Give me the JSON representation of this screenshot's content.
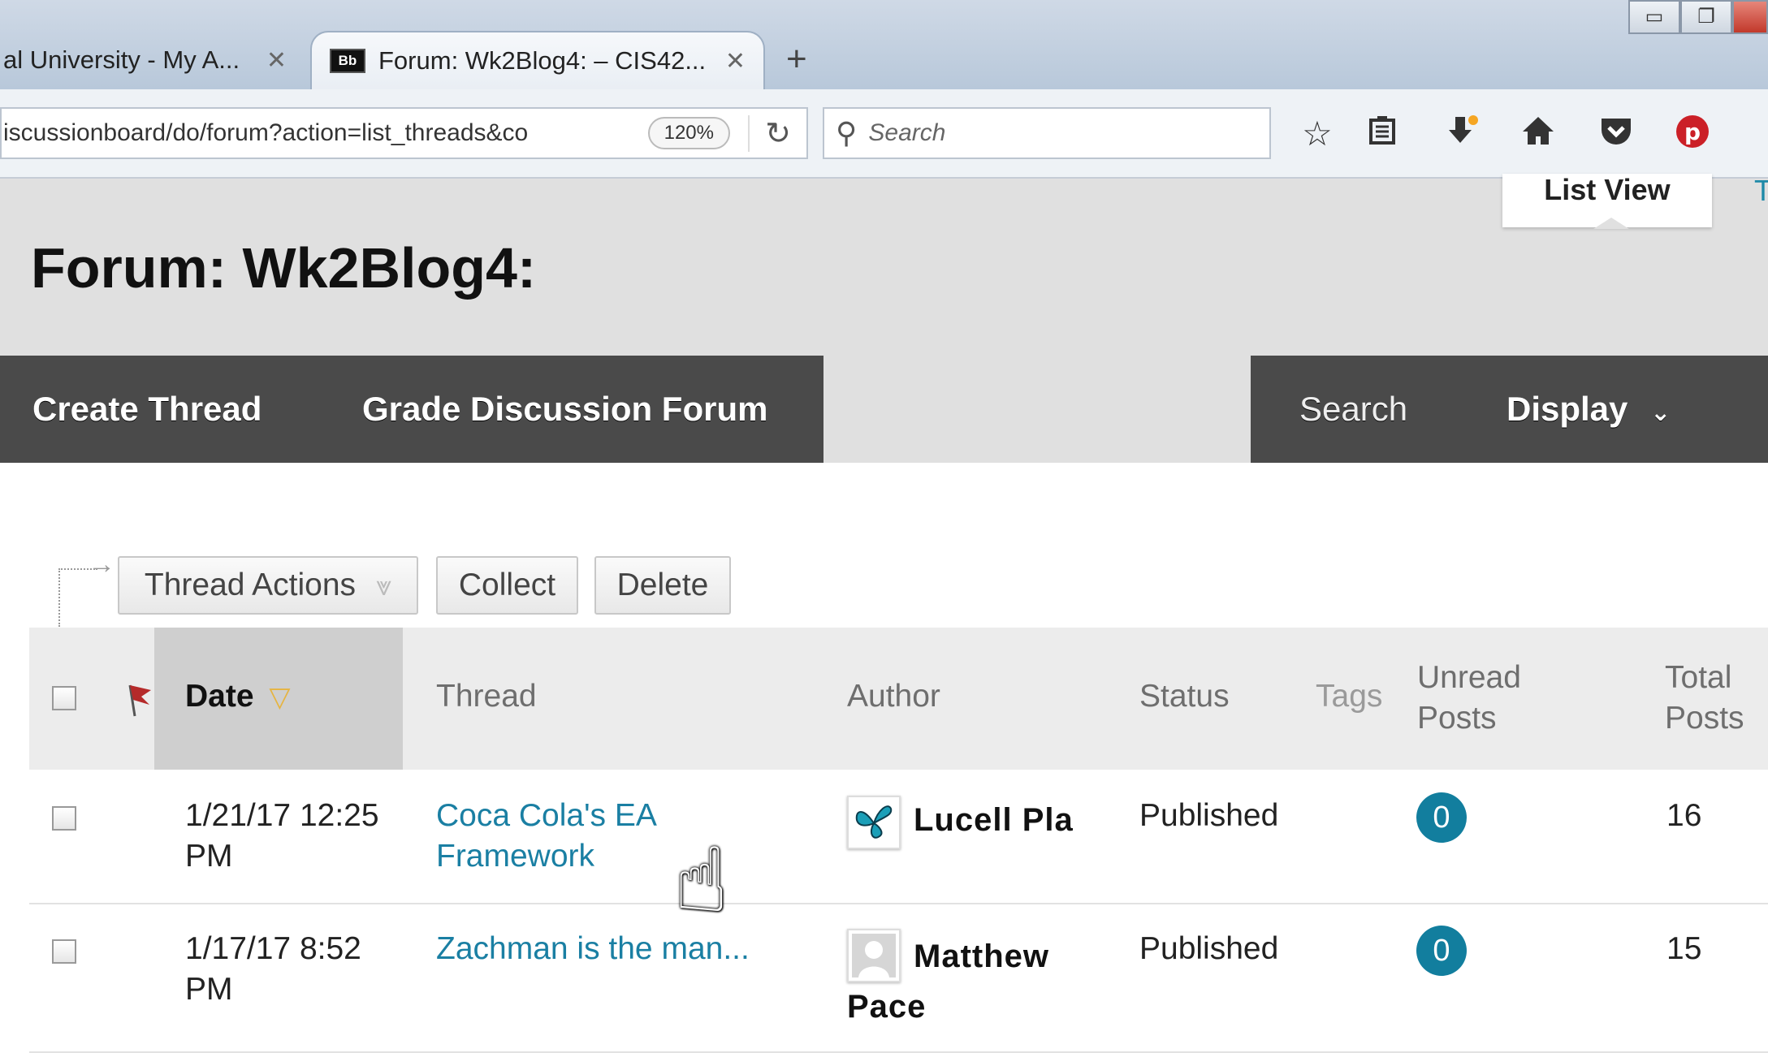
{
  "browser": {
    "tabs": [
      {
        "title": "al University - My A..."
      },
      {
        "title": "Forum: Wk2Blog4: – CIS42...",
        "favicon": "Bb"
      }
    ],
    "url": "iscussionboard/do/forum?action=list_threads&co",
    "zoom": "120%",
    "search_placeholder": "Search"
  },
  "page": {
    "title": "Forum: Wk2Blog4:",
    "view_mode": "List View",
    "cut_text": "T"
  },
  "actionbar": {
    "create_thread": "Create Thread",
    "grade_forum": "Grade Discussion Forum",
    "search": "Search",
    "display": "Display"
  },
  "list_controls": {
    "thread_actions": "Thread Actions",
    "collect": "Collect",
    "delete": "Delete"
  },
  "table": {
    "headers": {
      "date": "Date",
      "thread": "Thread",
      "author": "Author",
      "status": "Status",
      "tags": "Tags",
      "unread_1": "Unread",
      "unread_2": "Posts",
      "total_1": "Total",
      "total_2": "Posts"
    },
    "rows": [
      {
        "date_line1": "1/21/17 12:25",
        "date_line2": "PM",
        "thread_line1": "Coca Cola's EA",
        "thread_line2": "Framework",
        "author": "Lucell Pla",
        "status": "Published",
        "unread": "0",
        "total": "16"
      },
      {
        "date_line1": "1/17/17 8:52",
        "date_line2": "PM",
        "thread_line1": "Zachman is the man...",
        "author": "Matthew",
        "author_line2": "Pace",
        "status": "Published",
        "unread": "0",
        "total": "15"
      }
    ]
  },
  "colors": {
    "accent_link": "#1a7fa3",
    "badge": "#127e9e",
    "actionbar": "#4a4a4a",
    "header_bg": "#e0e0e0"
  }
}
